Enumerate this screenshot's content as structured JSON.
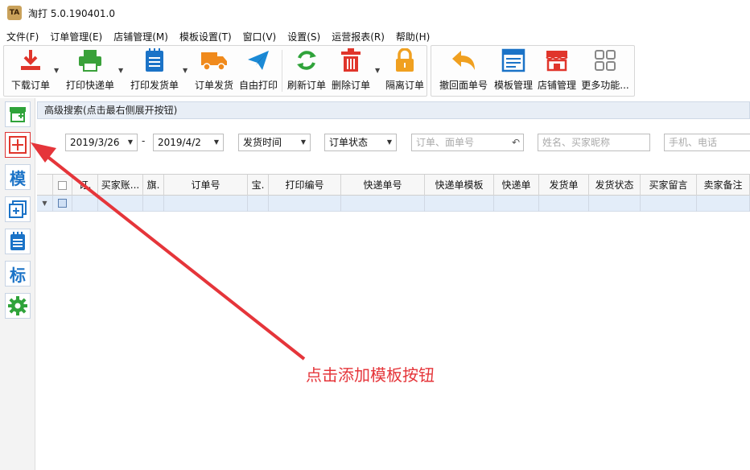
{
  "window": {
    "title": "淘打 5.0.190401.0",
    "app_icon_text": "TA"
  },
  "menu": [
    "文件(F)",
    "订单管理(E)",
    "店铺管理(M)",
    "模板设置(T)",
    "窗口(V)",
    "设置(S)",
    "运营报表(R)",
    "帮助(H)"
  ],
  "toolbar": {
    "download": "下载订单",
    "print_express": "打印快递单",
    "print_invoice": "打印发货单",
    "ship": "订单发货",
    "free_print": "自由打印",
    "refresh": "刷新订单",
    "delete": "删除订单",
    "isolate": "隔离订单",
    "revoke": "撤回面单号",
    "template": "模板管理",
    "shop": "店铺管理",
    "more": "更多功能..."
  },
  "sidebar": {
    "template_char": "模",
    "label_char": "标"
  },
  "search": {
    "header": "高级搜索(点击最右侧展开按钮)",
    "date_from": "2019/3/26",
    "date_sep": "-",
    "date_to": "2019/4/2",
    "time_type": "发货时间",
    "order_status": "订单状态",
    "order_placeholder": "订单、面单号",
    "name_placeholder": "姓名、买家昵称",
    "phone_placeholder": "手机、电话"
  },
  "columns": [
    "订.",
    "买家账...",
    "旗.",
    "订单号",
    "宝.",
    "打印编号",
    "快递单号",
    "快递单模板",
    "快递单",
    "发货单",
    "发货状态",
    "买家留言",
    "卖家备注"
  ],
  "annotation": "点击添加模板按钮",
  "colors": {
    "arrow": "#e5353a",
    "accent": "#1b73c7"
  }
}
